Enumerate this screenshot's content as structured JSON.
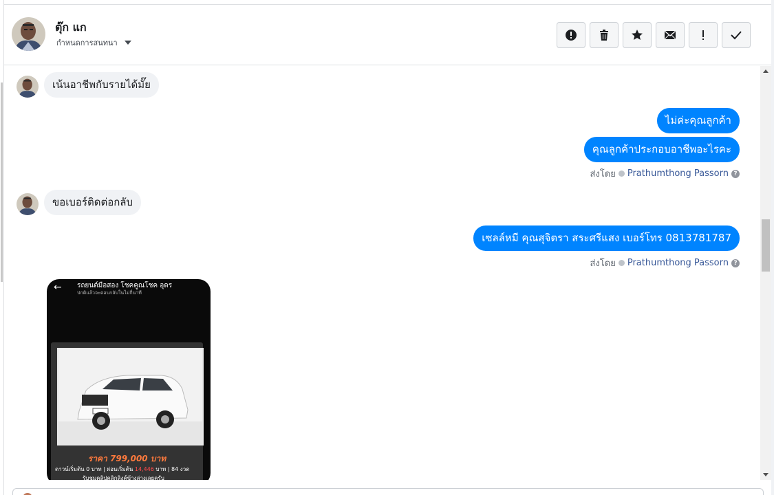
{
  "header": {
    "contact_name": "ตุ๊ก แก",
    "assign_label": "กำหนดการสนทนา",
    "actions": [
      {
        "name": "report-spam-button",
        "icon": "alert-circle-icon"
      },
      {
        "name": "delete-button",
        "icon": "trash-icon"
      },
      {
        "name": "star-button",
        "icon": "star-icon"
      },
      {
        "name": "mark-unread-button",
        "icon": "envelope-icon"
      },
      {
        "name": "follow-up-button",
        "icon": "exclamation-icon"
      },
      {
        "name": "mark-done-button",
        "icon": "checkmark-icon"
      }
    ]
  },
  "messages": {
    "m1": "เน้นอาชีพกับรายได้มั๊ย",
    "m2": "ไม่ค่ะคุณลูกค้า",
    "m3": "คุณลูกค้าประกอบอาชีพอะไรคะ",
    "m4": "ขอเบอร์ติดต่อกลับ",
    "m5": "เซลล์หมี คุณสุจิตรา สระศรีแสง เบอร์โทร 0813781787"
  },
  "sent_by": {
    "prefix": "ส่งโดย",
    "sender": "Prathumthong Passorn",
    "help": "?"
  },
  "image": {
    "title": "รถยนต์มือสอง โชคคูณโชค อุดร",
    "subtitle": "ปกติแล้วจะตอบกลับในไม่กี่นาที",
    "price": "ราคา 799,000 บาท",
    "terms_a": "ดาวน์เริ่มต้น 0 บาท | ผ่อนเริ่มต้น ",
    "terms_amount": "14,446",
    "terms_b": " บาท | 84 งวด",
    "note": "รับชมคลิปคลิกลิงค์ข้างล่างเลยครับ"
  },
  "colors": {
    "outgoing_bubble": "#0084ff",
    "incoming_bubble": "#f0f2f5",
    "sender_link": "#385898"
  }
}
